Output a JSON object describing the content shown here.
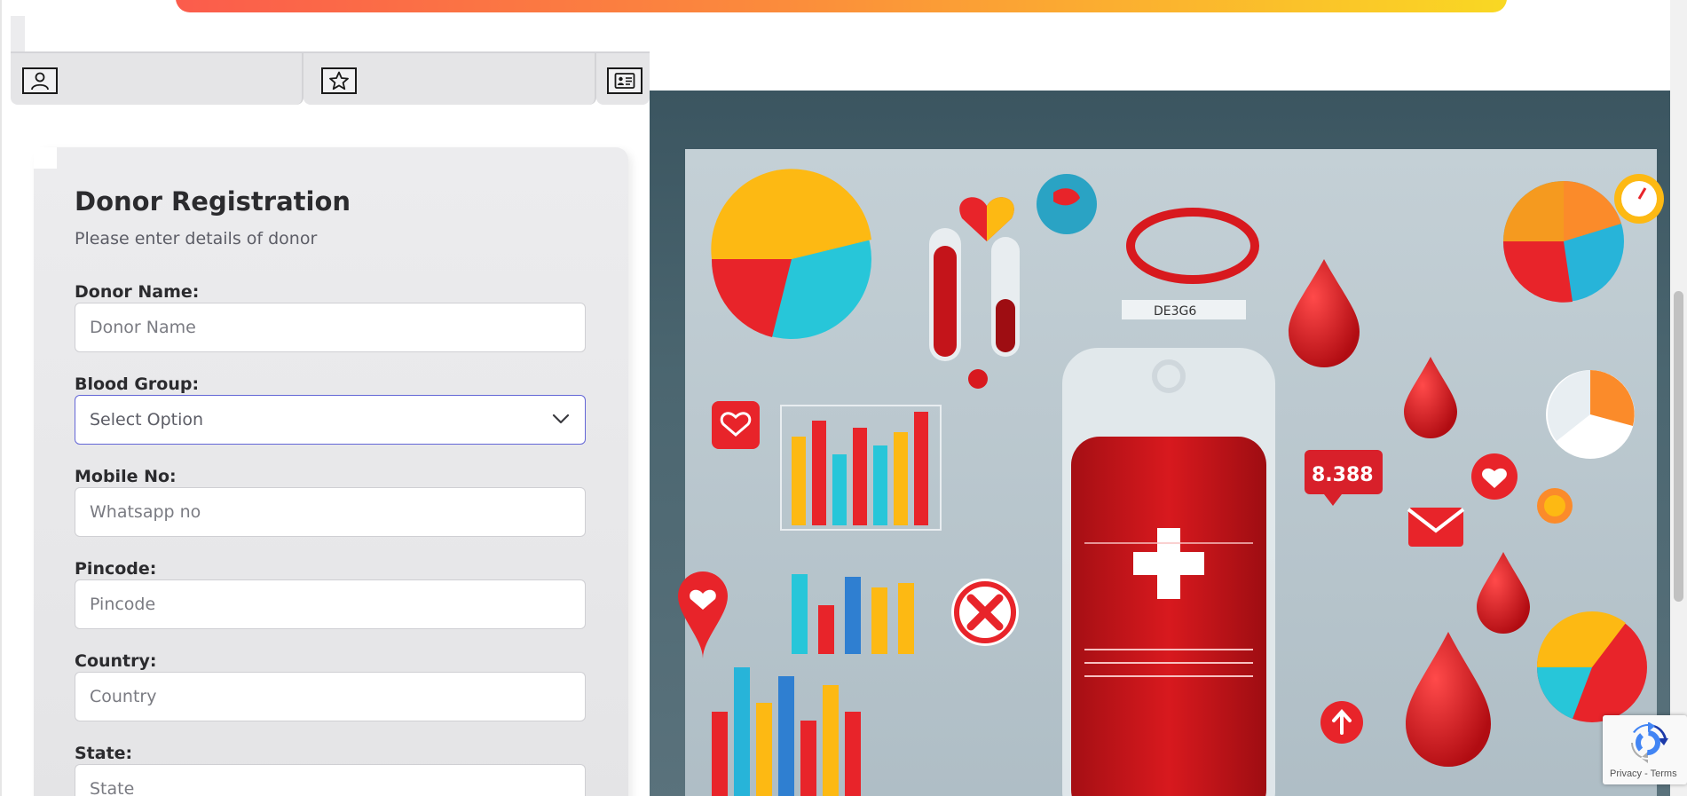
{
  "banner": {
    "gradient_start": "#fb5c4c",
    "gradient_end": "#f9d823"
  },
  "tabs": [
    {
      "icon": "user-icon"
    },
    {
      "icon": "star-icon"
    },
    {
      "icon": "id-card-icon"
    }
  ],
  "form": {
    "title": "Donor Registration",
    "subtitle": "Please enter details of donor",
    "fields": {
      "donor_name": {
        "label": "Donor Name:",
        "placeholder": "Donor Name"
      },
      "blood_group": {
        "label": "Blood Group:",
        "selected": "Select Option"
      },
      "mobile": {
        "label": "Mobile No:",
        "placeholder": "Whatsapp no"
      },
      "pincode": {
        "label": "Pincode:",
        "placeholder": "Pincode"
      },
      "country": {
        "label": "Country:",
        "placeholder": "Country"
      },
      "state": {
        "label": "State:",
        "placeholder": "State"
      }
    }
  },
  "hero": {
    "badge_text": "8.388",
    "tag_text": "DE3G6"
  },
  "recaptcha": {
    "links": "Privacy - Terms"
  },
  "colors": {
    "accent": "#6366d6",
    "blood": "#d01a1f"
  }
}
